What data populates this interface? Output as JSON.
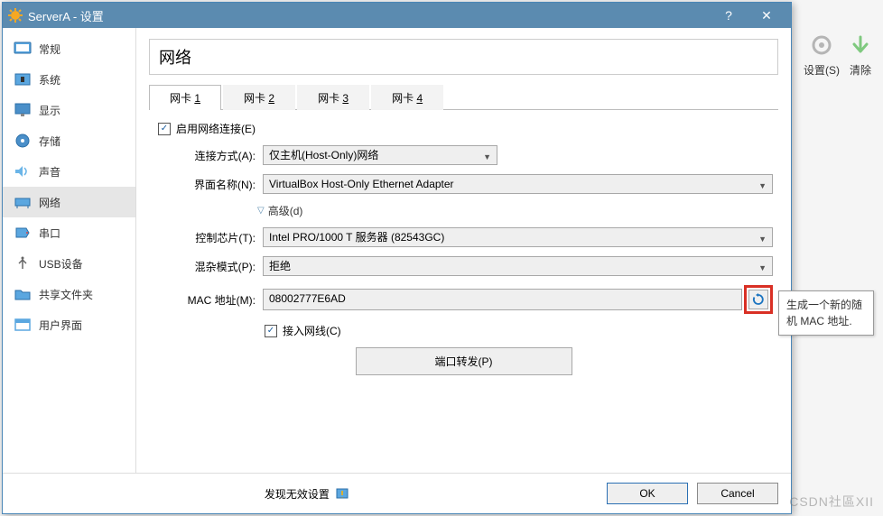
{
  "bg": {
    "settings_label": "设置(S)",
    "clear_label": "清除"
  },
  "titlebar": {
    "title": "ServerA - 设置",
    "help": "?",
    "close": "✕"
  },
  "sidebar": {
    "items": [
      {
        "label": "常规",
        "name": "sidebar-item-general"
      },
      {
        "label": "系统",
        "name": "sidebar-item-system"
      },
      {
        "label": "显示",
        "name": "sidebar-item-display"
      },
      {
        "label": "存储",
        "name": "sidebar-item-storage"
      },
      {
        "label": "声音",
        "name": "sidebar-item-audio"
      },
      {
        "label": "网络",
        "name": "sidebar-item-network"
      },
      {
        "label": "串口",
        "name": "sidebar-item-serial"
      },
      {
        "label": "USB设备",
        "name": "sidebar-item-usb"
      },
      {
        "label": "共享文件夹",
        "name": "sidebar-item-shared-folders"
      },
      {
        "label": "用户界面",
        "name": "sidebar-item-ui"
      }
    ]
  },
  "main": {
    "title": "网络",
    "tabs": [
      {
        "label": "网卡 ",
        "num": "1"
      },
      {
        "label": "网卡 ",
        "num": "2"
      },
      {
        "label": "网卡 ",
        "num": "3"
      },
      {
        "label": "网卡 ",
        "num": "4"
      }
    ],
    "enable_label": "启用网络连接(E)",
    "attach_label": "连接方式(A):",
    "attach_value": "仅主机(Host-Only)网络",
    "name_label": "界面名称(N):",
    "name_value": "VirtualBox Host-Only Ethernet Adapter",
    "advanced_label": "高级(d)",
    "adapter_label": "控制芯片(T):",
    "adapter_value": "Intel PRO/1000 T 服务器 (82543GC)",
    "promisc_label": "混杂模式(P):",
    "promisc_value": "拒绝",
    "mac_label": "MAC 地址(M):",
    "mac_value": "08002777E6AD",
    "cable_label": "接入网线(C)",
    "portfwd_label": "端口转发(P)"
  },
  "footer": {
    "warning": "发现无效设置",
    "ok": "OK",
    "cancel": "Cancel"
  },
  "tooltip": {
    "text": "生成一个新的随机 MAC 地址."
  },
  "watermark": "CSDN社區XII"
}
